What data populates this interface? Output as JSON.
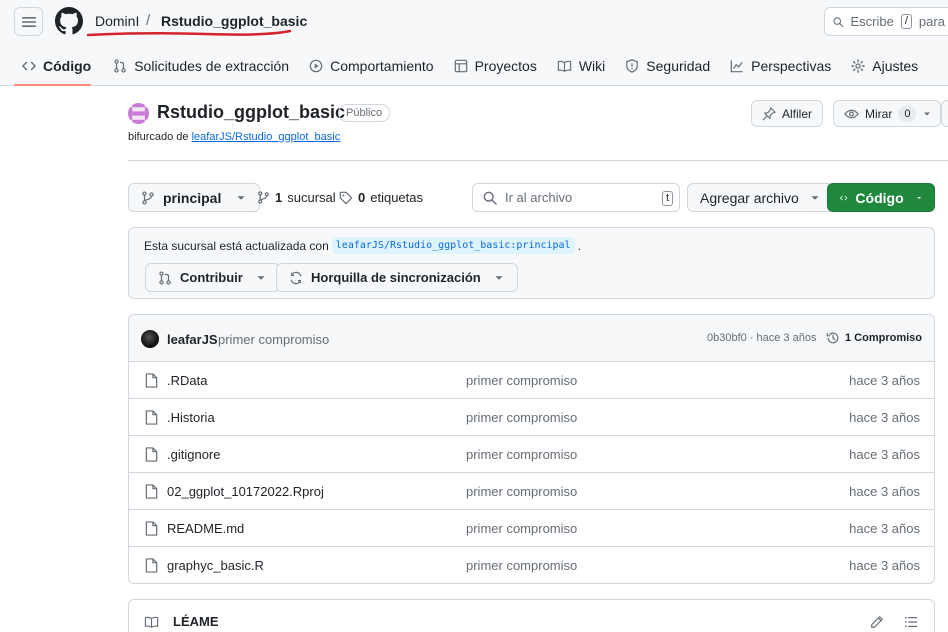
{
  "header": {
    "owner": "DominI",
    "separator": "/",
    "repo": "Rstudio_ggplot_basic",
    "search_prefix": "Escribe",
    "search_key": "/",
    "search_suffix": "para bu"
  },
  "tabs": [
    {
      "label": "Código",
      "icon": "code-icon"
    },
    {
      "label": "Solicitudes de extracción",
      "icon": "pull-request-icon"
    },
    {
      "label": "Comportamiento",
      "icon": "play-icon"
    },
    {
      "label": "Proyectos",
      "icon": "table-icon"
    },
    {
      "label": "Wiki",
      "icon": "book-icon"
    },
    {
      "label": "Seguridad",
      "icon": "shield-icon"
    },
    {
      "label": "Perspectivas",
      "icon": "graph-icon"
    },
    {
      "label": "Ajustes",
      "icon": "gear-icon"
    }
  ],
  "repo": {
    "title": "Rstudio_ggplot_basic",
    "visibility": "Público",
    "forked_prefix": "bifurcado de",
    "forked_link": "leafarJS/Rstudio_ggplot_basic",
    "pin_label": "Alfiler",
    "watch_label": "Mirar",
    "watch_count": "0"
  },
  "branch_bar": {
    "branch": "principal",
    "branches_count": "1",
    "branches_label": "sucursal",
    "tags_count": "0",
    "tags_label": "etiquetas",
    "go_to_file": "Ir al archivo",
    "go_key": "t",
    "add_file": "Agregar archivo",
    "code_button": "Código"
  },
  "status": {
    "text": "Esta sucursal está actualizada con",
    "ref": "leafarJS/Rstudio_ggplot_basic:principal",
    "end": ".",
    "contribute": "Contribuir",
    "sync_fork": "Horquilla de sincronización"
  },
  "commit": {
    "author": "leafarJS",
    "message": "primer compromiso",
    "hash_time": "0b30bf0 · hace 3 años",
    "count_label": "1 Compromiso"
  },
  "files": [
    {
      "name": ".RData",
      "message": "primer compromiso",
      "age": "hace 3 años"
    },
    {
      "name": ".Historia",
      "message": "primer compromiso",
      "age": "hace 3 años"
    },
    {
      "name": ".gitignore",
      "message": "primer compromiso",
      "age": "hace 3 años"
    },
    {
      "name": "02_ggplot_10172022.Rproj",
      "message": "primer compromiso",
      "age": "hace 3 años"
    },
    {
      "name": "README.md",
      "message": "primer compromiso",
      "age": "hace 3 años"
    },
    {
      "name": "graphyc_basic.R",
      "message": "primer compromiso",
      "age": "hace 3 años"
    }
  ],
  "readme": {
    "title": "LÉAME"
  },
  "colors": {
    "accent_green": "#1f883d",
    "link_blue": "#0969da",
    "tab_underline": "#fd8c73",
    "annotation_red": "#d1242f"
  }
}
